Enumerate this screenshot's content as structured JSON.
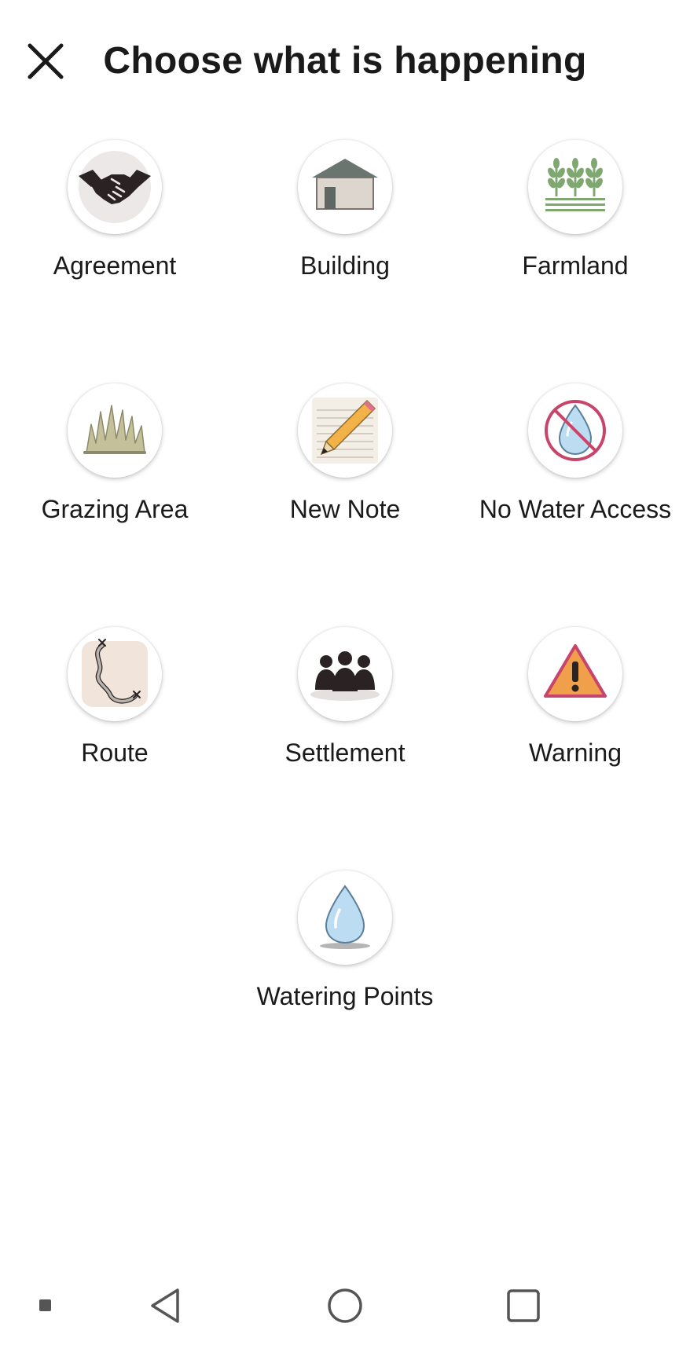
{
  "header": {
    "title": "Choose what is happening",
    "close_icon": "close-icon"
  },
  "categories": [
    {
      "label": "Agreement",
      "icon": "handshake-icon"
    },
    {
      "label": "Building",
      "icon": "building-icon"
    },
    {
      "label": "Farmland",
      "icon": "farmland-icon"
    },
    {
      "label": "Grazing Area",
      "icon": "grass-icon"
    },
    {
      "label": "New Note",
      "icon": "note-pencil-icon"
    },
    {
      "label": "No Water Access",
      "icon": "no-water-icon"
    },
    {
      "label": "Route",
      "icon": "route-icon"
    },
    {
      "label": "Settlement",
      "icon": "people-icon"
    },
    {
      "label": "Warning",
      "icon": "warning-icon"
    },
    {
      "label": "Watering Points",
      "icon": "water-drop-icon"
    }
  ],
  "navbar": {
    "items": [
      "recent-apps-dot-icon",
      "back-icon",
      "home-icon",
      "overview-icon"
    ]
  },
  "colors": {
    "text": "#1a1a1a",
    "farmland_green": "#7fa870",
    "warning_orange": "#f0a04b",
    "warning_red": "#c8446b",
    "water_blue": "#bcdcf2"
  }
}
